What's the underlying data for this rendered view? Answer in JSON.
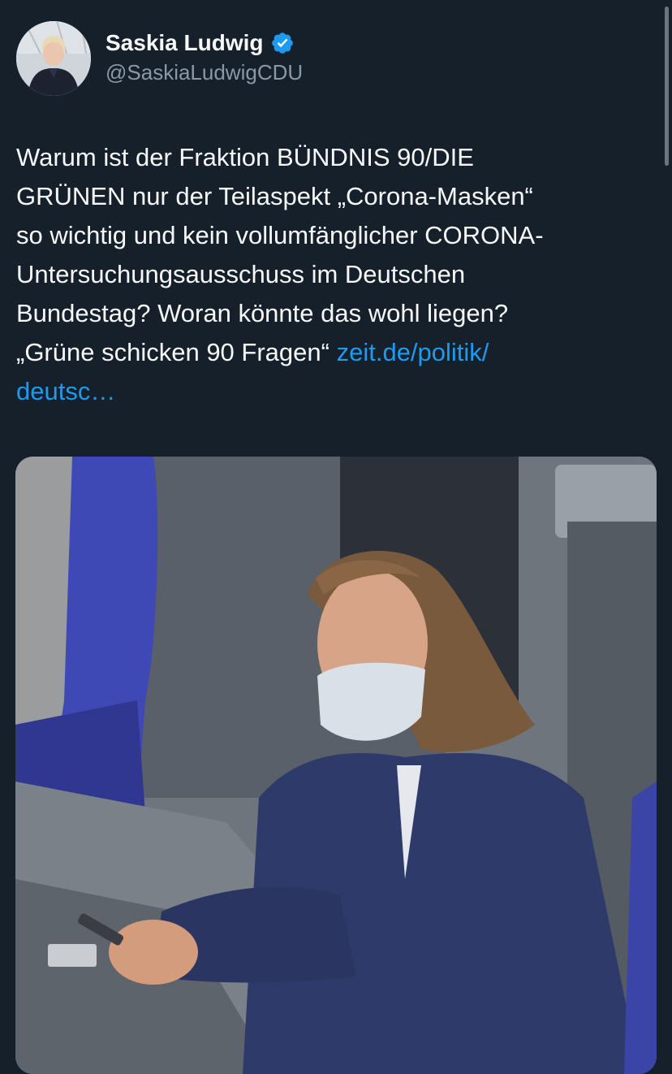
{
  "author": {
    "display_name": "Saskia Ludwig",
    "handle": "@SaskiaLudwigCDU",
    "verified_icon": "verified-badge-icon",
    "avatar_icon": "avatar-photo"
  },
  "tweet": {
    "lines": [
      "Warum ist der Fraktion BÜNDNIS 90/DIE",
      "GRÜNEN nur der Teilaspekt „Corona-Masken“",
      "so wichtig und kein vollumfänglicher CORONA-",
      "Untersuchungsausschuss im Deutschen",
      "Bundestag? Woran könnte das wohl liegen?"
    ],
    "quote_text": "„Grüne schicken 90 Fragen“",
    "link_line1": "zeit.de/politik/",
    "link_line2": "deutsc…"
  },
  "media": {
    "description_icon": "attached-photo"
  },
  "colors": {
    "background": "#15202b",
    "text": "#f7f9f9",
    "secondary": "#8b98a5",
    "link": "#1d9bf0"
  }
}
